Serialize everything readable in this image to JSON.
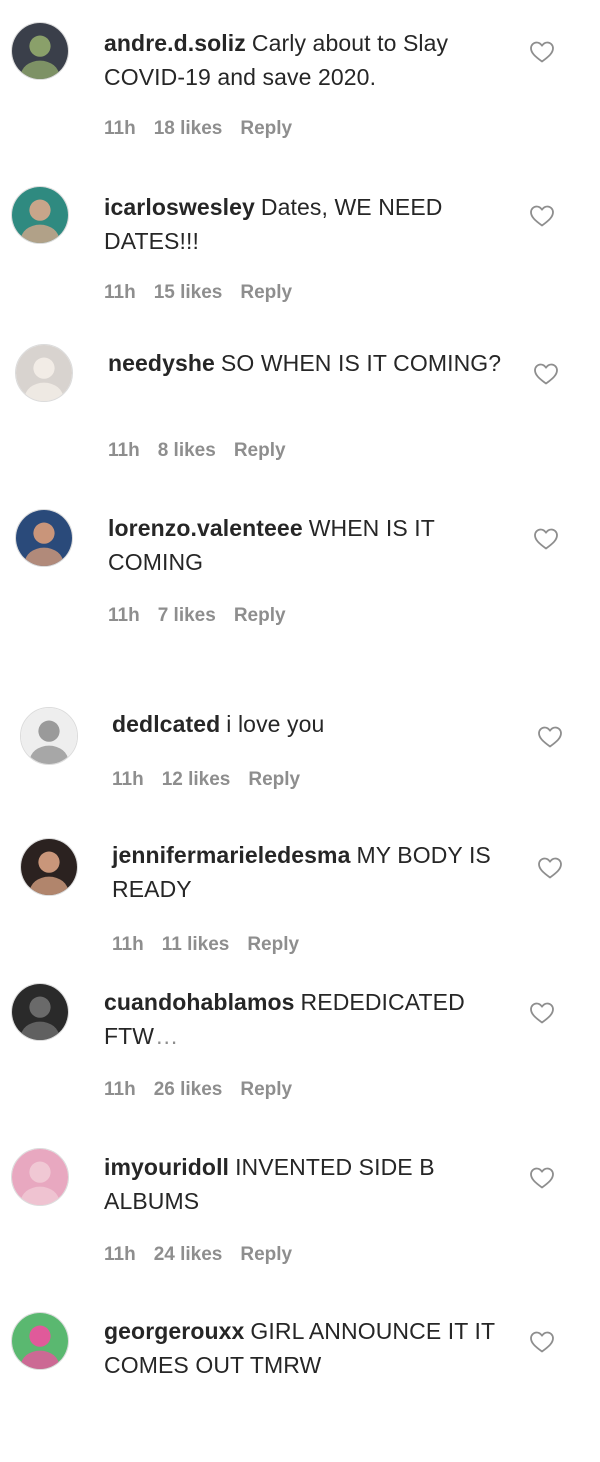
{
  "comments": [
    {
      "username": "andre.d.soliz",
      "text": "Carly about to Slay COVID-19 and save 2020.",
      "time": "11h",
      "likes": "18 likes",
      "reply": "Reply",
      "avatar": {
        "bg": "#3a3f4a",
        "accent": "#8aa06a"
      }
    },
    {
      "username": "icarloswesley",
      "text": "Dates, WE NEED DATES!!!",
      "time": "11h",
      "likes": "15 likes",
      "reply": "Reply",
      "avatar": {
        "bg": "#2f8a80",
        "accent": "#c8a58a"
      }
    },
    {
      "username": "needyshe",
      "text": "SO WHEN IS IT COMING?",
      "time": "11h",
      "likes": "8 likes",
      "reply": "Reply",
      "avatar": {
        "bg": "#d8d3cf",
        "accent": "#f2ece6"
      }
    },
    {
      "username": "lorenzo.valenteee",
      "text": "WHEN IS IT COMING",
      "time": "11h",
      "likes": "7 likes",
      "reply": "Reply",
      "avatar": {
        "bg": "#2a4a7a",
        "accent": "#c9957a"
      }
    },
    {
      "username": "dedlcated",
      "text": "i love you",
      "time": "11h",
      "likes": "12 likes",
      "reply": "Reply",
      "avatar": {
        "bg": "#eeeeee",
        "accent": "#9a9a9a"
      }
    },
    {
      "username": "jennifermarieledesma",
      "text": "MY BODY IS READY",
      "time": "11h",
      "likes": "11 likes",
      "reply": "Reply",
      "avatar": {
        "bg": "#2b2220",
        "accent": "#c9967a"
      }
    },
    {
      "username": "cuandohablamos",
      "text": "REDEDICATED FTW",
      "truncated_marker": "...",
      "time": "11h",
      "likes": "26 likes",
      "reply": "Reply",
      "avatar": {
        "bg": "#2a2a2a",
        "accent": "#6a6a6a"
      }
    },
    {
      "username": "imyouridoll",
      "text": "INVENTED SIDE B ALBUMS",
      "time": "11h",
      "likes": "24 likes",
      "reply": "Reply",
      "avatar": {
        "bg": "#e8a8c0",
        "accent": "#f0c8d4"
      }
    },
    {
      "username": "georgerouxx",
      "text": "GIRL ANNOUNCE IT IT COMES OUT TMRW",
      "time": "",
      "likes": "",
      "reply": "",
      "avatar": {
        "bg": "#5ab870",
        "accent": "#e05a9a"
      }
    }
  ],
  "icons": {
    "like": "heart-outline-icon"
  },
  "colors": {
    "text": "#262626",
    "meta": "#8e8e8e",
    "heart_stroke": "#8e8e8e",
    "avatar_border": "#dbdbdb"
  }
}
